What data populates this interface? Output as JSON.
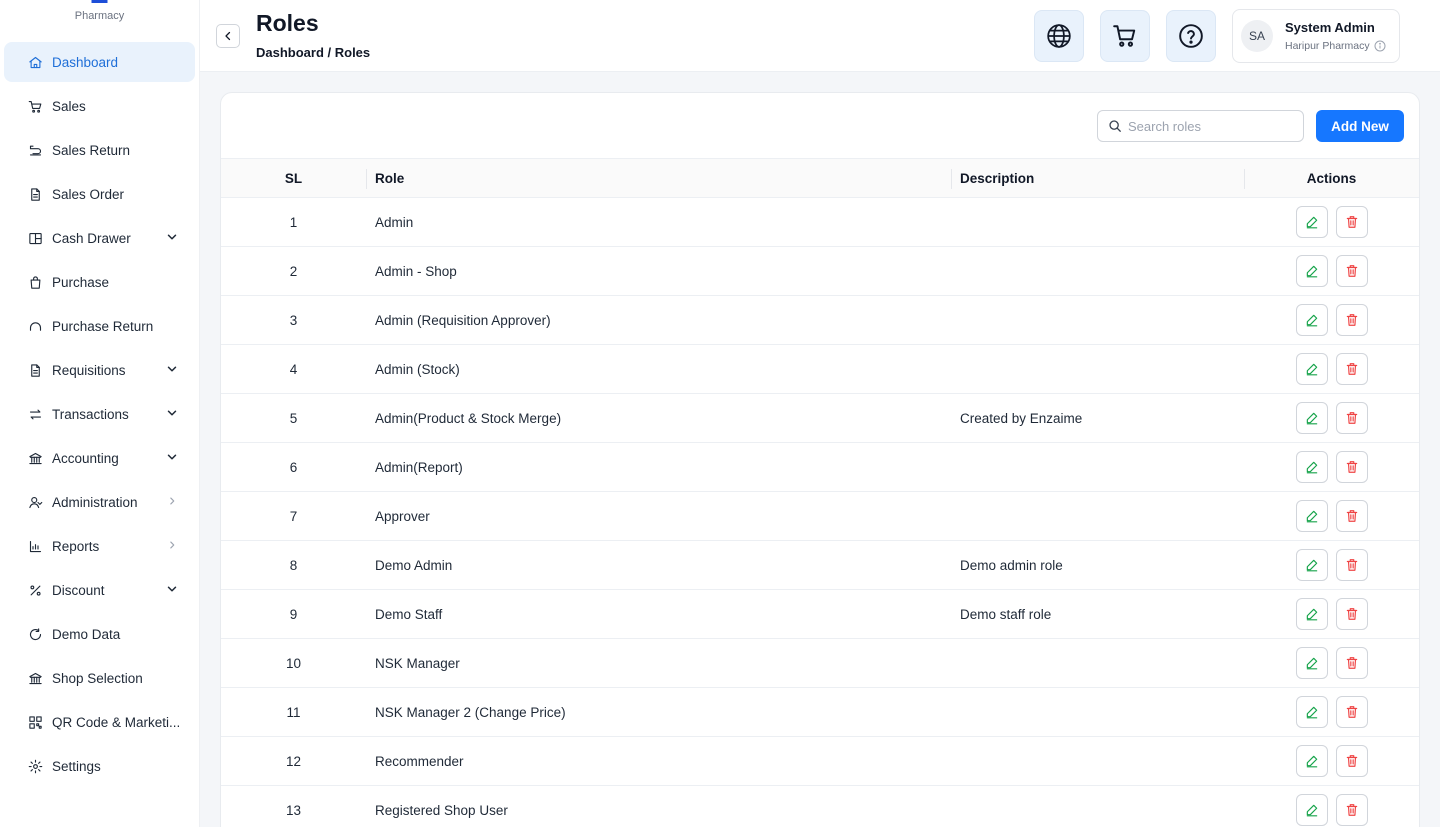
{
  "brand": {
    "subtitle": "Pharmacy"
  },
  "sidebar": {
    "items": [
      {
        "label": "Dashboard",
        "icon": "home-icon",
        "active": true,
        "caret": "none"
      },
      {
        "label": "Sales",
        "icon": "cart-icon",
        "caret": "none"
      },
      {
        "label": "Sales Return",
        "icon": "return-icon",
        "caret": "none"
      },
      {
        "label": "Sales Order",
        "icon": "document-icon",
        "caret": "none"
      },
      {
        "label": "Cash Drawer",
        "icon": "drawer-icon",
        "caret": "down"
      },
      {
        "label": "Purchase",
        "icon": "bag-icon",
        "caret": "none"
      },
      {
        "label": "Purchase Return",
        "icon": "refresh-icon",
        "caret": "none"
      },
      {
        "label": "Requisitions",
        "icon": "document-icon",
        "caret": "down"
      },
      {
        "label": "Transactions",
        "icon": "transfer-icon",
        "caret": "down"
      },
      {
        "label": "Accounting",
        "icon": "bank-icon",
        "caret": "down"
      },
      {
        "label": "Administration",
        "icon": "users-icon",
        "caret": "right"
      },
      {
        "label": "Reports",
        "icon": "bar-chart-icon",
        "caret": "right"
      },
      {
        "label": "Discount",
        "icon": "percent-icon",
        "caret": "down"
      },
      {
        "label": "Demo Data",
        "icon": "reload-icon",
        "caret": "none"
      },
      {
        "label": "Shop Selection",
        "icon": "bank-icon",
        "caret": "none"
      },
      {
        "label": "QR Code & Marketi...",
        "icon": "qr-code-icon",
        "caret": "none"
      },
      {
        "label": "Settings",
        "icon": "gear-icon",
        "caret": "none"
      }
    ]
  },
  "header": {
    "title": "Roles",
    "breadcrumb": "Dashboard / Roles",
    "user": {
      "initials": "SA",
      "name": "System Admin",
      "shop": "Haripur Pharmacy"
    }
  },
  "toolbar": {
    "search_placeholder": "Search roles",
    "add_label": "Add New"
  },
  "table": {
    "headers": {
      "sl": "SL",
      "role": "Role",
      "description": "Description",
      "actions": "Actions"
    },
    "rows": [
      {
        "sl": "1",
        "role": "Admin",
        "description": ""
      },
      {
        "sl": "2",
        "role": "Admin - Shop",
        "description": ""
      },
      {
        "sl": "3",
        "role": "Admin (Requisition Approver)",
        "description": ""
      },
      {
        "sl": "4",
        "role": "Admin (Stock)",
        "description": ""
      },
      {
        "sl": "5",
        "role": "Admin(Product & Stock Merge)",
        "description": "Created by Enzaime"
      },
      {
        "sl": "6",
        "role": "Admin(Report)",
        "description": ""
      },
      {
        "sl": "7",
        "role": "Approver",
        "description": ""
      },
      {
        "sl": "8",
        "role": "Demo Admin",
        "description": "Demo admin role"
      },
      {
        "sl": "9",
        "role": "Demo Staff",
        "description": "Demo staff role"
      },
      {
        "sl": "10",
        "role": "NSK Manager",
        "description": ""
      },
      {
        "sl": "11",
        "role": "NSK Manager 2 (Change Price)",
        "description": ""
      },
      {
        "sl": "12",
        "role": "Recommender",
        "description": ""
      },
      {
        "sl": "13",
        "role": "Registered Shop User",
        "description": ""
      }
    ]
  },
  "colors": {
    "accent": "#1677ff",
    "active_bg": "#e9f2fc",
    "edit": "#16a34a",
    "delete": "#ef4444"
  }
}
